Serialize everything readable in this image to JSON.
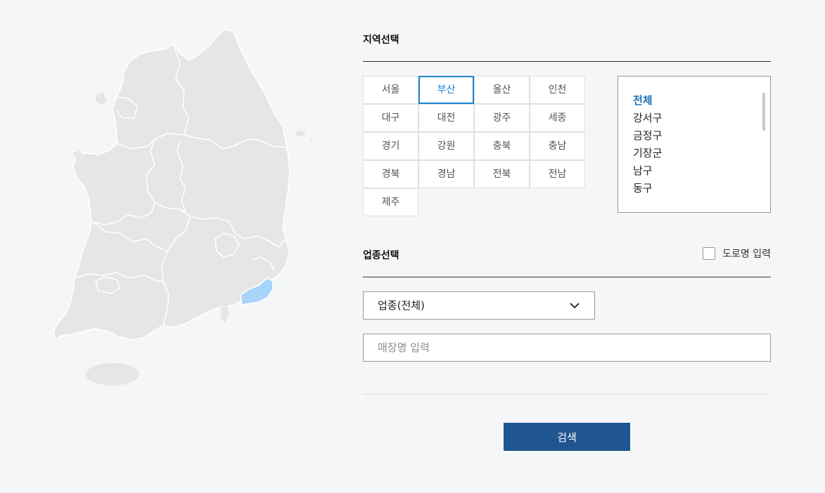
{
  "region_section": {
    "title": "지역선택",
    "regions": [
      "서울",
      "부산",
      "울산",
      "인천",
      "대구",
      "대전",
      "광주",
      "세종",
      "경기",
      "강원",
      "충북",
      "충남",
      "경북",
      "경남",
      "전북",
      "전남",
      "제주"
    ],
    "selected_region": "부산"
  },
  "district_list": {
    "items": [
      "전체",
      "강서구",
      "금정구",
      "기장군",
      "남구",
      "동구"
    ],
    "selected": "전체"
  },
  "business_section": {
    "title": "업종선택",
    "road_name_label": "도로명 입력",
    "road_name_checked": false,
    "business_select_value": "업종(전체)",
    "store_name_placeholder": "매장명 입력"
  },
  "search_button_label": "검색",
  "colors": {
    "page_bg": "#f5f6f8",
    "accent": "#1a86d0",
    "button_bg": "#1f5590",
    "map_fill": "#e6e6e6",
    "map_highlight": "#a9d4fb"
  },
  "icons": {
    "select_arrow": "chevron-down-icon"
  }
}
